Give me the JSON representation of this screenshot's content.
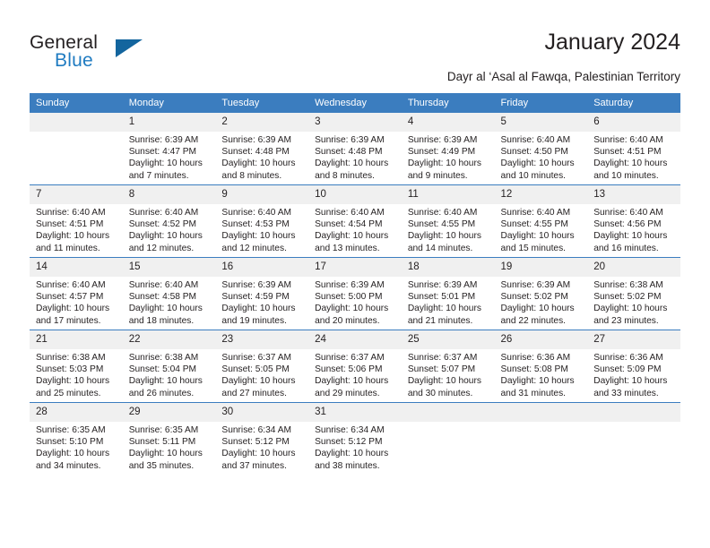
{
  "brand": {
    "name_top": "General",
    "name_bottom": "Blue",
    "triangle_color": "#13659e",
    "blue_color": "#1f7bc1"
  },
  "header": {
    "title": "January 2024",
    "subtitle": "Dayr al ‘Asal al Fawqa, Palestinian Territory"
  },
  "theme": {
    "header_bg": "#3b7dbf",
    "daynum_bg": "#f0f0f0",
    "text": "#231f20"
  },
  "calendar": {
    "weekday_headers": [
      "Sunday",
      "Monday",
      "Tuesday",
      "Wednesday",
      "Thursday",
      "Friday",
      "Saturday"
    ],
    "weeks": [
      [
        {
          "day": "",
          "sunrise": "",
          "sunset": "",
          "daylight_line1": "",
          "daylight_line2": ""
        },
        {
          "day": "1",
          "sunrise": "Sunrise: 6:39 AM",
          "sunset": "Sunset: 4:47 PM",
          "daylight_line1": "Daylight: 10 hours",
          "daylight_line2": "and 7 minutes."
        },
        {
          "day": "2",
          "sunrise": "Sunrise: 6:39 AM",
          "sunset": "Sunset: 4:48 PM",
          "daylight_line1": "Daylight: 10 hours",
          "daylight_line2": "and 8 minutes."
        },
        {
          "day": "3",
          "sunrise": "Sunrise: 6:39 AM",
          "sunset": "Sunset: 4:48 PM",
          "daylight_line1": "Daylight: 10 hours",
          "daylight_line2": "and 8 minutes."
        },
        {
          "day": "4",
          "sunrise": "Sunrise: 6:39 AM",
          "sunset": "Sunset: 4:49 PM",
          "daylight_line1": "Daylight: 10 hours",
          "daylight_line2": "and 9 minutes."
        },
        {
          "day": "5",
          "sunrise": "Sunrise: 6:40 AM",
          "sunset": "Sunset: 4:50 PM",
          "daylight_line1": "Daylight: 10 hours",
          "daylight_line2": "and 10 minutes."
        },
        {
          "day": "6",
          "sunrise": "Sunrise: 6:40 AM",
          "sunset": "Sunset: 4:51 PM",
          "daylight_line1": "Daylight: 10 hours",
          "daylight_line2": "and 10 minutes."
        }
      ],
      [
        {
          "day": "7",
          "sunrise": "Sunrise: 6:40 AM",
          "sunset": "Sunset: 4:51 PM",
          "daylight_line1": "Daylight: 10 hours",
          "daylight_line2": "and 11 minutes."
        },
        {
          "day": "8",
          "sunrise": "Sunrise: 6:40 AM",
          "sunset": "Sunset: 4:52 PM",
          "daylight_line1": "Daylight: 10 hours",
          "daylight_line2": "and 12 minutes."
        },
        {
          "day": "9",
          "sunrise": "Sunrise: 6:40 AM",
          "sunset": "Sunset: 4:53 PM",
          "daylight_line1": "Daylight: 10 hours",
          "daylight_line2": "and 12 minutes."
        },
        {
          "day": "10",
          "sunrise": "Sunrise: 6:40 AM",
          "sunset": "Sunset: 4:54 PM",
          "daylight_line1": "Daylight: 10 hours",
          "daylight_line2": "and 13 minutes."
        },
        {
          "day": "11",
          "sunrise": "Sunrise: 6:40 AM",
          "sunset": "Sunset: 4:55 PM",
          "daylight_line1": "Daylight: 10 hours",
          "daylight_line2": "and 14 minutes."
        },
        {
          "day": "12",
          "sunrise": "Sunrise: 6:40 AM",
          "sunset": "Sunset: 4:55 PM",
          "daylight_line1": "Daylight: 10 hours",
          "daylight_line2": "and 15 minutes."
        },
        {
          "day": "13",
          "sunrise": "Sunrise: 6:40 AM",
          "sunset": "Sunset: 4:56 PM",
          "daylight_line1": "Daylight: 10 hours",
          "daylight_line2": "and 16 minutes."
        }
      ],
      [
        {
          "day": "14",
          "sunrise": "Sunrise: 6:40 AM",
          "sunset": "Sunset: 4:57 PM",
          "daylight_line1": "Daylight: 10 hours",
          "daylight_line2": "and 17 minutes."
        },
        {
          "day": "15",
          "sunrise": "Sunrise: 6:40 AM",
          "sunset": "Sunset: 4:58 PM",
          "daylight_line1": "Daylight: 10 hours",
          "daylight_line2": "and 18 minutes."
        },
        {
          "day": "16",
          "sunrise": "Sunrise: 6:39 AM",
          "sunset": "Sunset: 4:59 PM",
          "daylight_line1": "Daylight: 10 hours",
          "daylight_line2": "and 19 minutes."
        },
        {
          "day": "17",
          "sunrise": "Sunrise: 6:39 AM",
          "sunset": "Sunset: 5:00 PM",
          "daylight_line1": "Daylight: 10 hours",
          "daylight_line2": "and 20 minutes."
        },
        {
          "day": "18",
          "sunrise": "Sunrise: 6:39 AM",
          "sunset": "Sunset: 5:01 PM",
          "daylight_line1": "Daylight: 10 hours",
          "daylight_line2": "and 21 minutes."
        },
        {
          "day": "19",
          "sunrise": "Sunrise: 6:39 AM",
          "sunset": "Sunset: 5:02 PM",
          "daylight_line1": "Daylight: 10 hours",
          "daylight_line2": "and 22 minutes."
        },
        {
          "day": "20",
          "sunrise": "Sunrise: 6:38 AM",
          "sunset": "Sunset: 5:02 PM",
          "daylight_line1": "Daylight: 10 hours",
          "daylight_line2": "and 23 minutes."
        }
      ],
      [
        {
          "day": "21",
          "sunrise": "Sunrise: 6:38 AM",
          "sunset": "Sunset: 5:03 PM",
          "daylight_line1": "Daylight: 10 hours",
          "daylight_line2": "and 25 minutes."
        },
        {
          "day": "22",
          "sunrise": "Sunrise: 6:38 AM",
          "sunset": "Sunset: 5:04 PM",
          "daylight_line1": "Daylight: 10 hours",
          "daylight_line2": "and 26 minutes."
        },
        {
          "day": "23",
          "sunrise": "Sunrise: 6:37 AM",
          "sunset": "Sunset: 5:05 PM",
          "daylight_line1": "Daylight: 10 hours",
          "daylight_line2": "and 27 minutes."
        },
        {
          "day": "24",
          "sunrise": "Sunrise: 6:37 AM",
          "sunset": "Sunset: 5:06 PM",
          "daylight_line1": "Daylight: 10 hours",
          "daylight_line2": "and 29 minutes."
        },
        {
          "day": "25",
          "sunrise": "Sunrise: 6:37 AM",
          "sunset": "Sunset: 5:07 PM",
          "daylight_line1": "Daylight: 10 hours",
          "daylight_line2": "and 30 minutes."
        },
        {
          "day": "26",
          "sunrise": "Sunrise: 6:36 AM",
          "sunset": "Sunset: 5:08 PM",
          "daylight_line1": "Daylight: 10 hours",
          "daylight_line2": "and 31 minutes."
        },
        {
          "day": "27",
          "sunrise": "Sunrise: 6:36 AM",
          "sunset": "Sunset: 5:09 PM",
          "daylight_line1": "Daylight: 10 hours",
          "daylight_line2": "and 33 minutes."
        }
      ],
      [
        {
          "day": "28",
          "sunrise": "Sunrise: 6:35 AM",
          "sunset": "Sunset: 5:10 PM",
          "daylight_line1": "Daylight: 10 hours",
          "daylight_line2": "and 34 minutes."
        },
        {
          "day": "29",
          "sunrise": "Sunrise: 6:35 AM",
          "sunset": "Sunset: 5:11 PM",
          "daylight_line1": "Daylight: 10 hours",
          "daylight_line2": "and 35 minutes."
        },
        {
          "day": "30",
          "sunrise": "Sunrise: 6:34 AM",
          "sunset": "Sunset: 5:12 PM",
          "daylight_line1": "Daylight: 10 hours",
          "daylight_line2": "and 37 minutes."
        },
        {
          "day": "31",
          "sunrise": "Sunrise: 6:34 AM",
          "sunset": "Sunset: 5:12 PM",
          "daylight_line1": "Daylight: 10 hours",
          "daylight_line2": "and 38 minutes."
        },
        {
          "day": "",
          "sunrise": "",
          "sunset": "",
          "daylight_line1": "",
          "daylight_line2": ""
        },
        {
          "day": "",
          "sunrise": "",
          "sunset": "",
          "daylight_line1": "",
          "daylight_line2": ""
        },
        {
          "day": "",
          "sunrise": "",
          "sunset": "",
          "daylight_line1": "",
          "daylight_line2": ""
        }
      ]
    ]
  }
}
